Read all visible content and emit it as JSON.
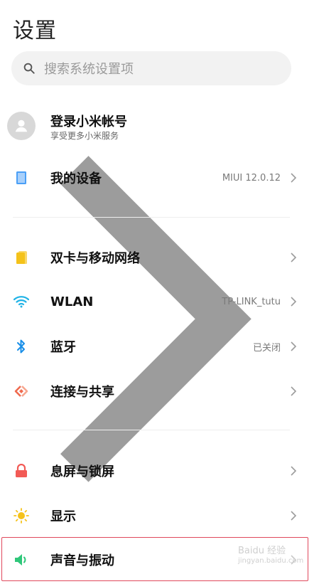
{
  "page": {
    "title": "设置"
  },
  "search": {
    "placeholder": "搜索系统设置项"
  },
  "account": {
    "title": "登录小米帐号",
    "subtitle": "享受更多小米服务"
  },
  "items": [
    {
      "label": "我的设备",
      "value": "MIUI 12.0.12"
    },
    {
      "label": "双卡与移动网络",
      "value": ""
    },
    {
      "label": "WLAN",
      "value": "TP-LINK_tutu"
    },
    {
      "label": "蓝牙",
      "value": "已关闭"
    },
    {
      "label": "连接与共享",
      "value": ""
    },
    {
      "label": "息屏与锁屏",
      "value": ""
    },
    {
      "label": "显示",
      "value": ""
    },
    {
      "label": "声音与振动",
      "value": ""
    }
  ],
  "watermark": {
    "line1": "Baidu 经验",
    "line2": "jingyan.baidu.com"
  },
  "colors": {
    "device_icon": "#4a9ff6",
    "sim_icon": "#f4c21a",
    "wlan_icon": "#20b3e6",
    "bluetooth_icon": "#1a8fe8",
    "share_icon": "#ef6a4f",
    "lock_icon": "#f25a55",
    "display_icon": "#f5c21b",
    "sound_icon": "#2fc77a",
    "highlight_border": "#e0485c",
    "notification_dot": "#e53b2f"
  }
}
